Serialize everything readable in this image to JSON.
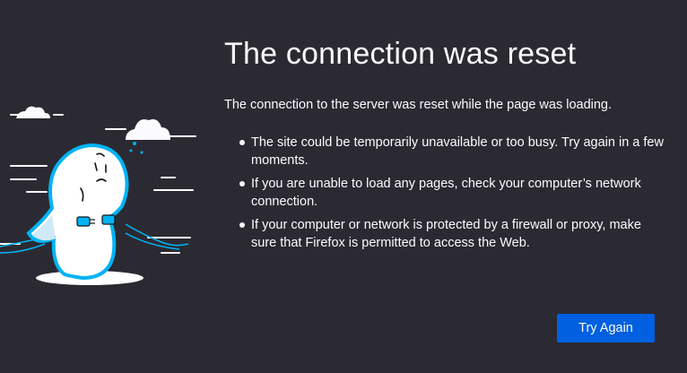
{
  "error": {
    "title": "The connection was reset",
    "summary": "The connection to the server was reset while the page was loading.",
    "reasons": [
      "The site could be temporarily unavailable or too busy. Try again in a few moments.",
      "If you are unable to load any pages, check your computer’s network connection.",
      "If your computer or network is protected by a firewall or proxy, make sure that Firefox is permitted to access the Web."
    ]
  },
  "actions": {
    "try_again_label": "Try Again"
  },
  "colors": {
    "background": "#2b2a33",
    "text": "#fbfbfe",
    "button": "#0060df",
    "illustration_accent": "#00b3f4"
  },
  "illustration": {
    "icon": "unplugged-dino-illustration"
  }
}
